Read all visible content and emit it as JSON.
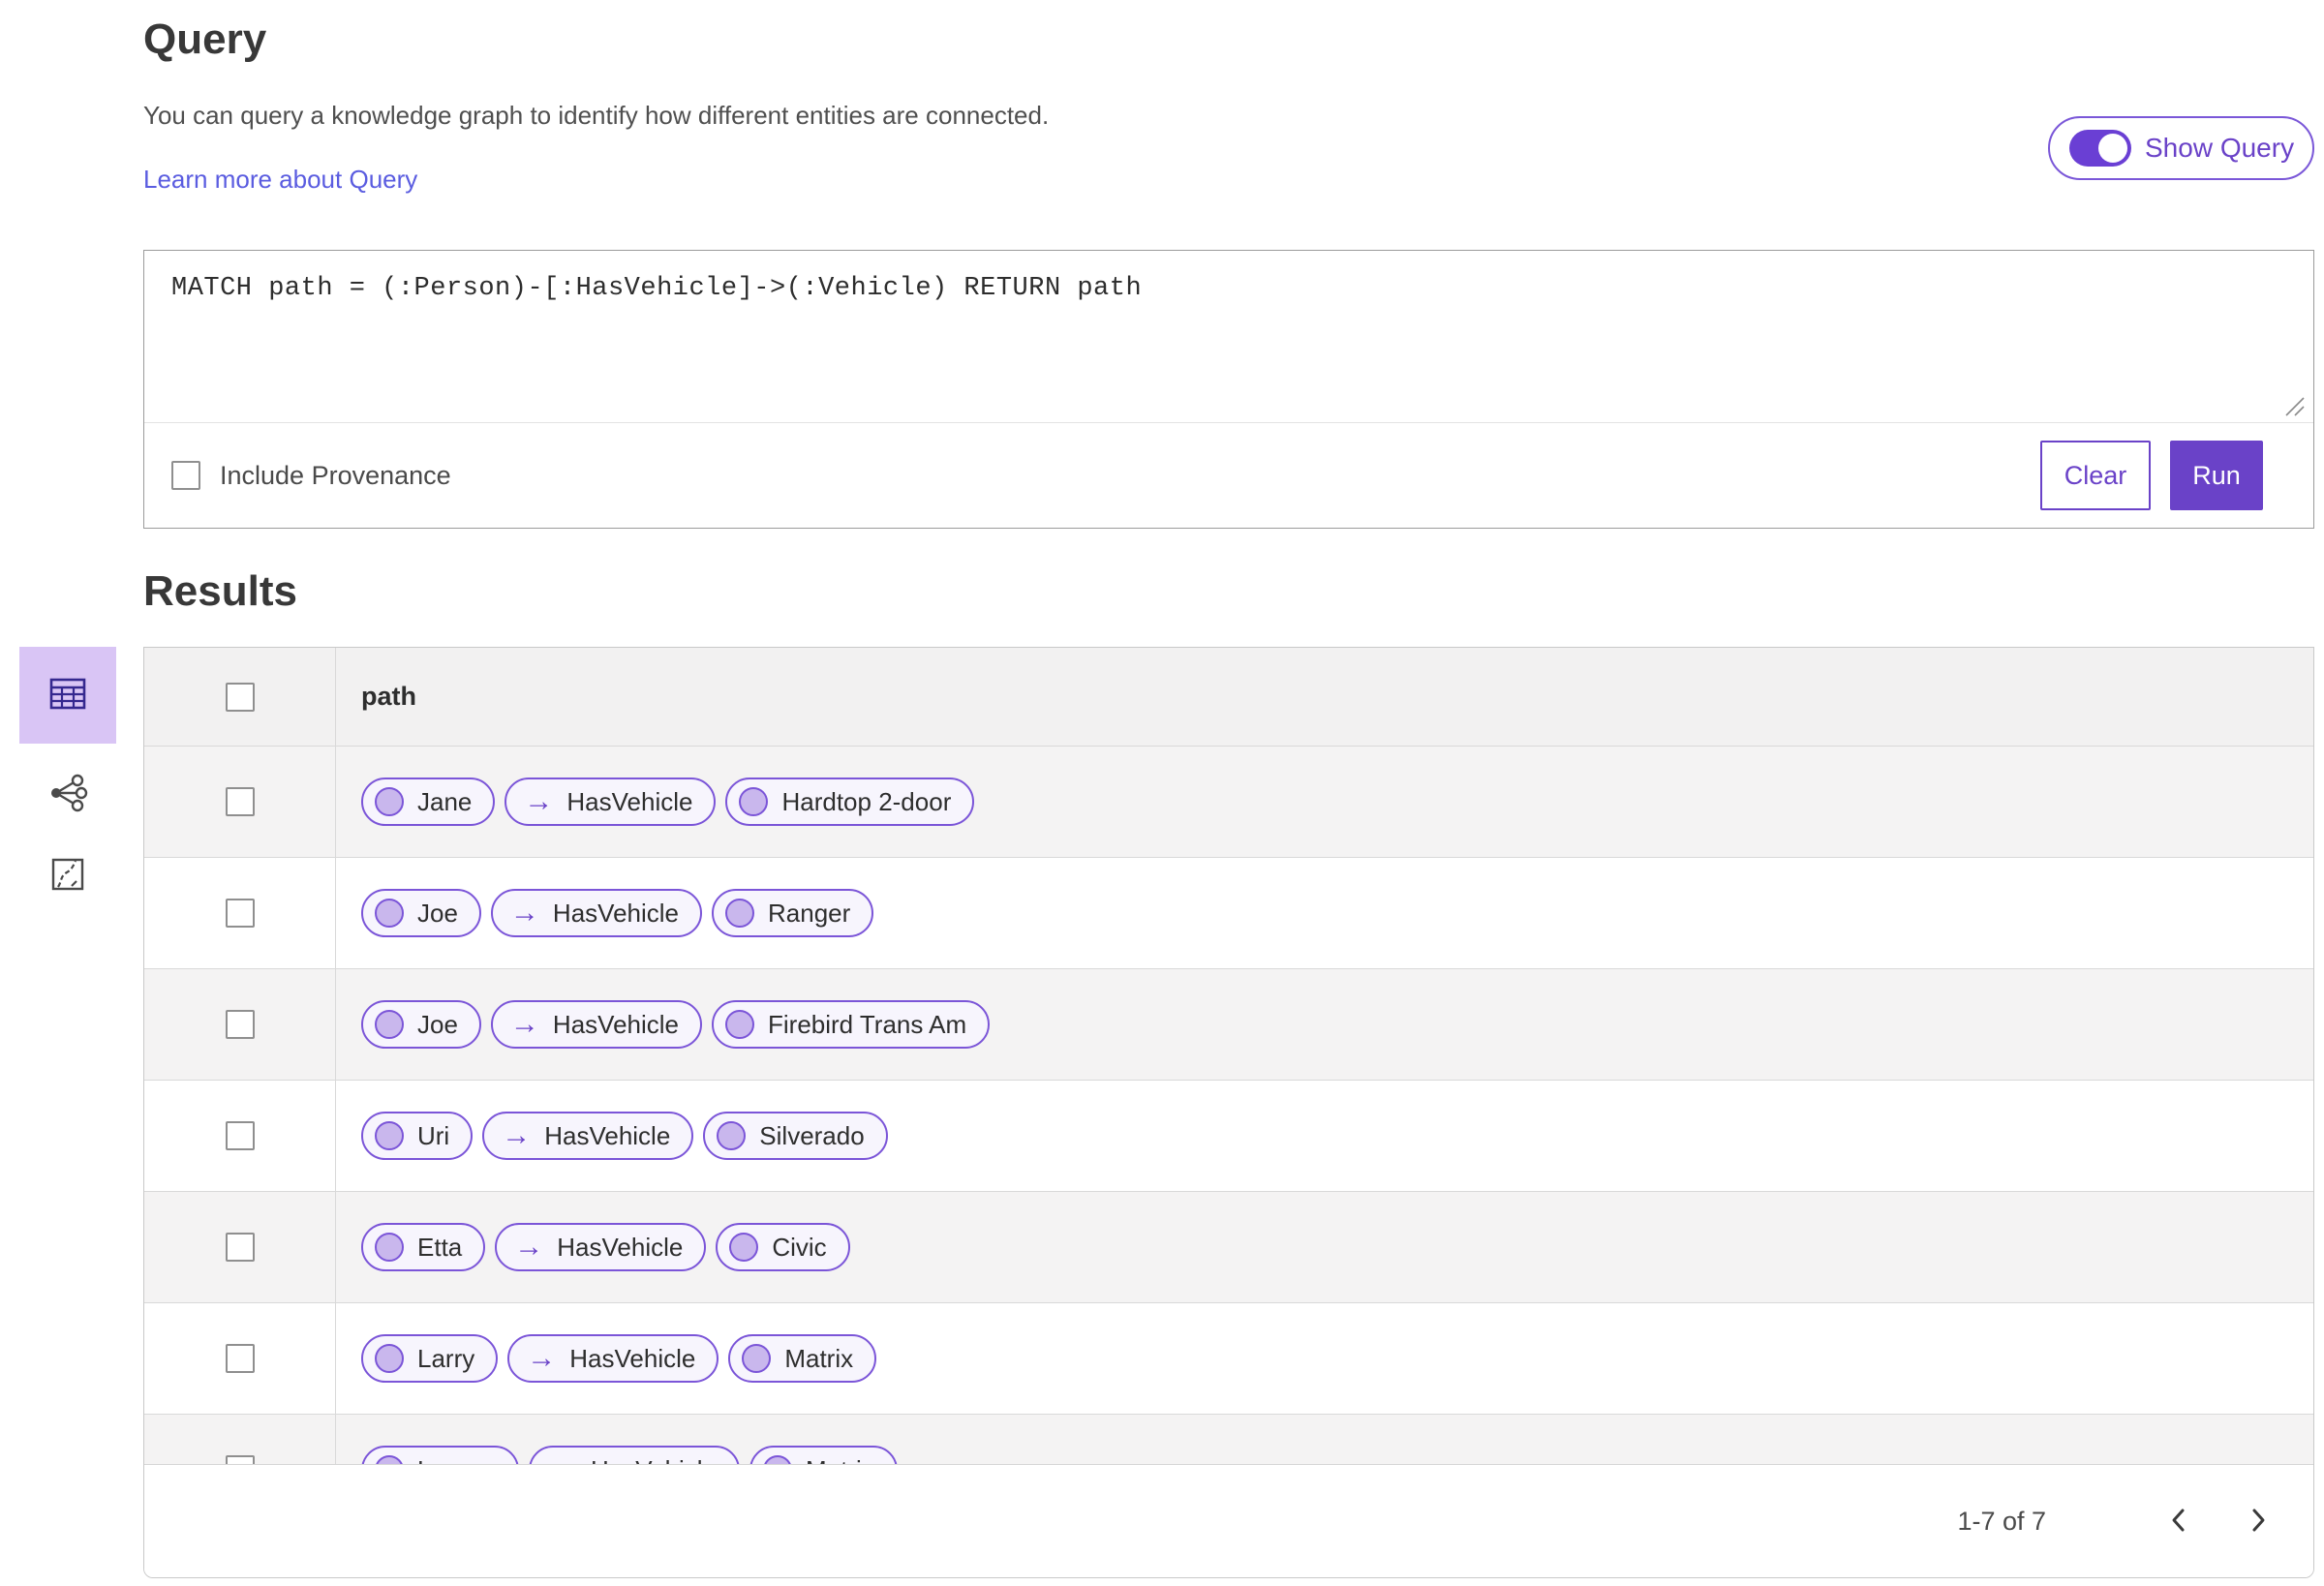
{
  "query_panel": {
    "title": "Query",
    "description": "You can query a knowledge graph to identify how different entities are connected.",
    "learn_more_label": "Learn more about Query",
    "show_query_label": "Show Query",
    "show_query_on": true,
    "query_text": "MATCH path = (:Person)-[:HasVehicle]->(:Vehicle) RETURN path",
    "include_provenance_label": "Include Provenance",
    "include_provenance_checked": false,
    "clear_label": "Clear",
    "run_label": "Run"
  },
  "results": {
    "title": "Results",
    "view_icons": [
      "table-view-icon",
      "link-chart-view-icon",
      "map-view-icon"
    ],
    "selected_view": "table-view-icon",
    "column_header": "path",
    "arrow_icon": "→",
    "rows": [
      {
        "source": "Jane",
        "relation": "HasVehicle",
        "target": "Hardtop 2-door"
      },
      {
        "source": "Joe",
        "relation": "HasVehicle",
        "target": "Ranger"
      },
      {
        "source": "Joe",
        "relation": "HasVehicle",
        "target": "Firebird Trans Am"
      },
      {
        "source": "Uri",
        "relation": "HasVehicle",
        "target": "Silverado"
      },
      {
        "source": "Etta",
        "relation": "HasVehicle",
        "target": "Civic"
      },
      {
        "source": "Larry",
        "relation": "HasVehicle",
        "target": "Matrix"
      },
      {
        "source": "Lauren",
        "relation": "HasVehicle",
        "target": "Matrix"
      }
    ],
    "pagination": {
      "range_label": "1-7 of 7"
    }
  },
  "colors": {
    "primary_purple": "#6a42c8",
    "toggle_purple": "#6a3fd4",
    "chip_border": "#7b55d8",
    "chip_background": "#f7f5fd",
    "node_fill": "#c9b7ed",
    "selected_view_background": "#d9c5f5",
    "link_color": "#5a5ce0",
    "alt_row_background": "#f4f3f3",
    "table_header_background": "#f2f1f1"
  }
}
